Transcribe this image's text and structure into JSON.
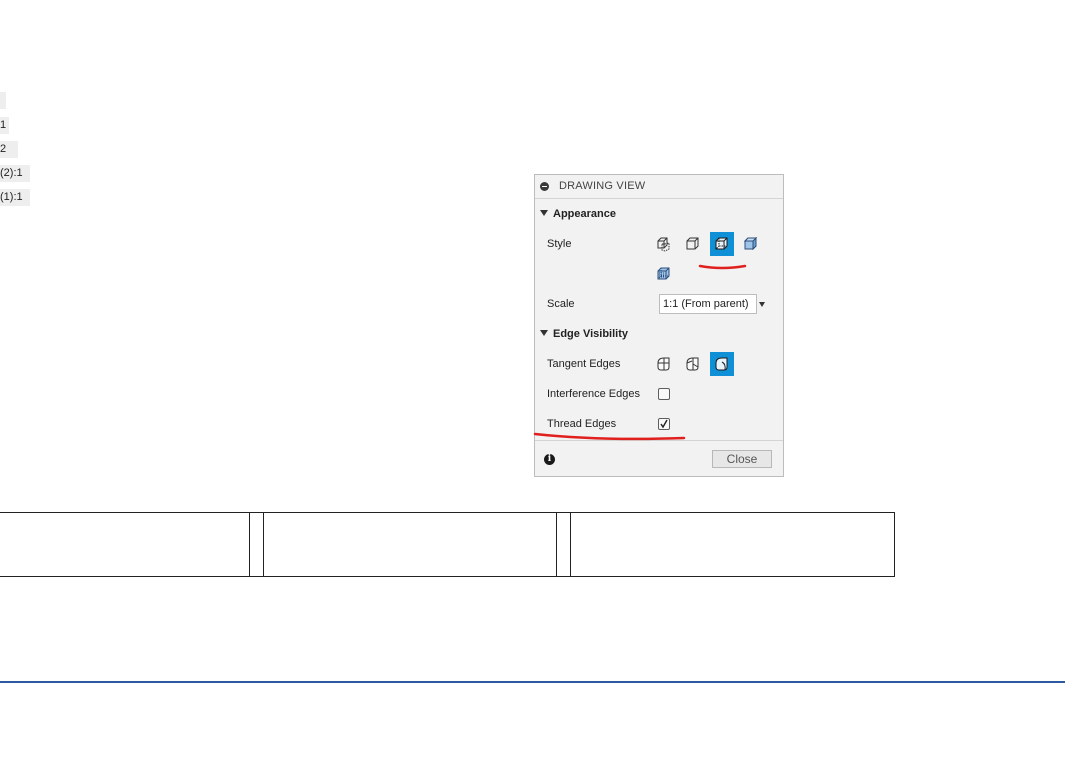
{
  "left_list": {
    "items": [
      "",
      "1",
      "2",
      "(2):1",
      "(1):1"
    ]
  },
  "panel": {
    "title": "DRAWING VIEW",
    "appearance": {
      "heading": "Appearance",
      "style_label": "Style",
      "style_icons": [
        "visible-and-hidden-edges-icon",
        "visible-edges-icon",
        "shaded-with-hidden-edges-icon",
        "shaded-icon",
        "shaded-hidden-edges-icon"
      ],
      "selected_style_index": 2,
      "scale_label": "Scale",
      "scale_value": "1:1 (From parent)"
    },
    "edge_visibility": {
      "heading": "Edge Visibility",
      "tangent_label": "Tangent Edges",
      "tangent_icons": [
        "tangent-edges-off-icon",
        "tangent-edges-on-icon",
        "tangent-edges-shortened-icon"
      ],
      "selected_tangent_index": 2,
      "interference_label": "Interference Edges",
      "interference_checked": false,
      "thread_label": "Thread Edges",
      "thread_checked": true
    },
    "footer": {
      "info": "i",
      "close_label": "Close"
    }
  },
  "colors": {
    "accent": "#0f8fd6",
    "annotation": "#e0201e",
    "rule": "#2c5aa0"
  }
}
